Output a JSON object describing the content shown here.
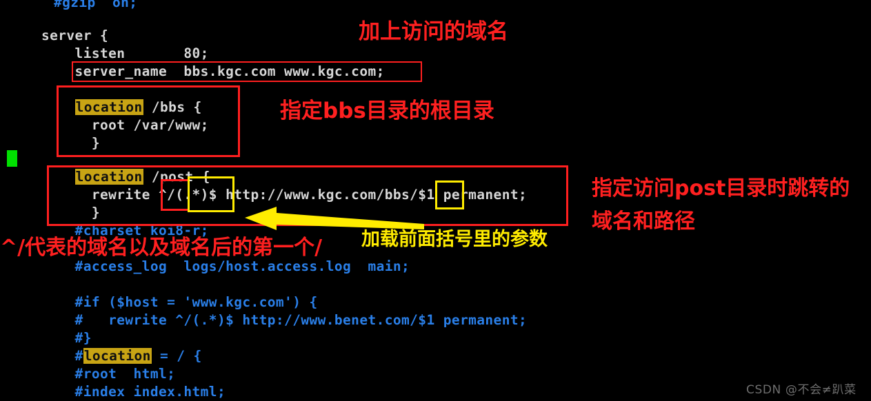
{
  "terminal": {
    "background": "#000000",
    "code_color": "#d7d7d7",
    "comment_color": "#2a7fe8",
    "highlight_bg": "#c8a414",
    "cursor_color": "#00e000",
    "lines": [
      {
        "id": "l0",
        "text": "#gzip  on;",
        "kind": "comment"
      },
      {
        "id": "l1",
        "text": "",
        "kind": "blank"
      },
      {
        "id": "l2",
        "text": "server {",
        "kind": "code"
      },
      {
        "id": "l3",
        "text": "    listen       80;",
        "kind": "code"
      },
      {
        "id": "l4",
        "text": "    server_name  bbs.kgc.com www.kgc.com;",
        "kind": "code"
      },
      {
        "id": "l5",
        "text": "",
        "kind": "blank"
      },
      {
        "id": "l6",
        "pre": "    ",
        "kw": "location",
        "post": " /bbs {",
        "kind": "code-kw"
      },
      {
        "id": "l7",
        "text": "      root /var/www;",
        "kind": "code"
      },
      {
        "id": "l8",
        "text": "      }",
        "kind": "code"
      },
      {
        "id": "l9",
        "text": "",
        "kind": "blank"
      },
      {
        "id": "l10",
        "pre": "    ",
        "kw": "location",
        "post": " /post {",
        "kind": "code-kw"
      },
      {
        "id": "l11",
        "text": "      rewrite ^/(.*)$ http://www.kgc.com/bbs/$1 permanent;",
        "kind": "code"
      },
      {
        "id": "l12",
        "text": "      }",
        "kind": "code"
      },
      {
        "id": "l13",
        "text": "    #charset koi8-r;",
        "kind": "comment"
      },
      {
        "id": "l14",
        "text": "",
        "kind": "blank"
      },
      {
        "id": "l15",
        "text": "    #access_log  logs/host.access.log  main;",
        "kind": "comment"
      },
      {
        "id": "l16",
        "text": "",
        "kind": "blank"
      },
      {
        "id": "l17",
        "text": "    #if ($host = 'www.kgc.com') {",
        "kind": "comment"
      },
      {
        "id": "l18",
        "text": "    #   rewrite ^/(.*)$ http://www.benet.com/$1 permanent;",
        "kind": "comment"
      },
      {
        "id": "l19",
        "text": "    #}",
        "kind": "comment"
      },
      {
        "id": "l20",
        "pre": "    #",
        "kw": "location",
        "post": " = / {",
        "kind": "comment-kw"
      },
      {
        "id": "l21",
        "text": "    #root  html;",
        "kind": "comment"
      },
      {
        "id": "l22",
        "text": "    #index index.html;",
        "kind": "comment"
      }
    ]
  },
  "annotations": {
    "server_name_note": {
      "text": "加上访问的域名",
      "color": "#ff2020"
    },
    "bbs_root_note": {
      "text": "指定bbs目录的根目录",
      "color": "#ff2020"
    },
    "post_note_line1": {
      "text": "指定访问post目录时跳转的",
      "color": "#ff2020"
    },
    "post_note_line2": {
      "text": "域名和路径",
      "color": "#ff2020"
    },
    "capture_note": {
      "text": "加载前面括号里的参数",
      "color": "#ffec00"
    },
    "caret_slash_note": {
      "text": "^/代表的域名以及域名后的第一个/",
      "color": "#ff2020"
    }
  },
  "highlight_boxes": {
    "server_name_box": {
      "color": "#ff1f1f",
      "style": "solid"
    },
    "bbs_location_box": {
      "color": "#ff1f1f",
      "style": "solid"
    },
    "post_location_box": {
      "color": "#ff1f1f",
      "style": "solid"
    },
    "caret_slash_box": {
      "color": "#ff1f1f",
      "style": "solid"
    },
    "capture_group_box": {
      "color": "#ffec00",
      "style": "solid"
    },
    "dollar_one_box": {
      "color": "#ffec00",
      "style": "solid"
    }
  },
  "arrow": {
    "color": "#ffec00",
    "direction": "left"
  },
  "watermark": {
    "text": "CSDN @不会≠趴菜",
    "color": "#6e6e6e"
  }
}
